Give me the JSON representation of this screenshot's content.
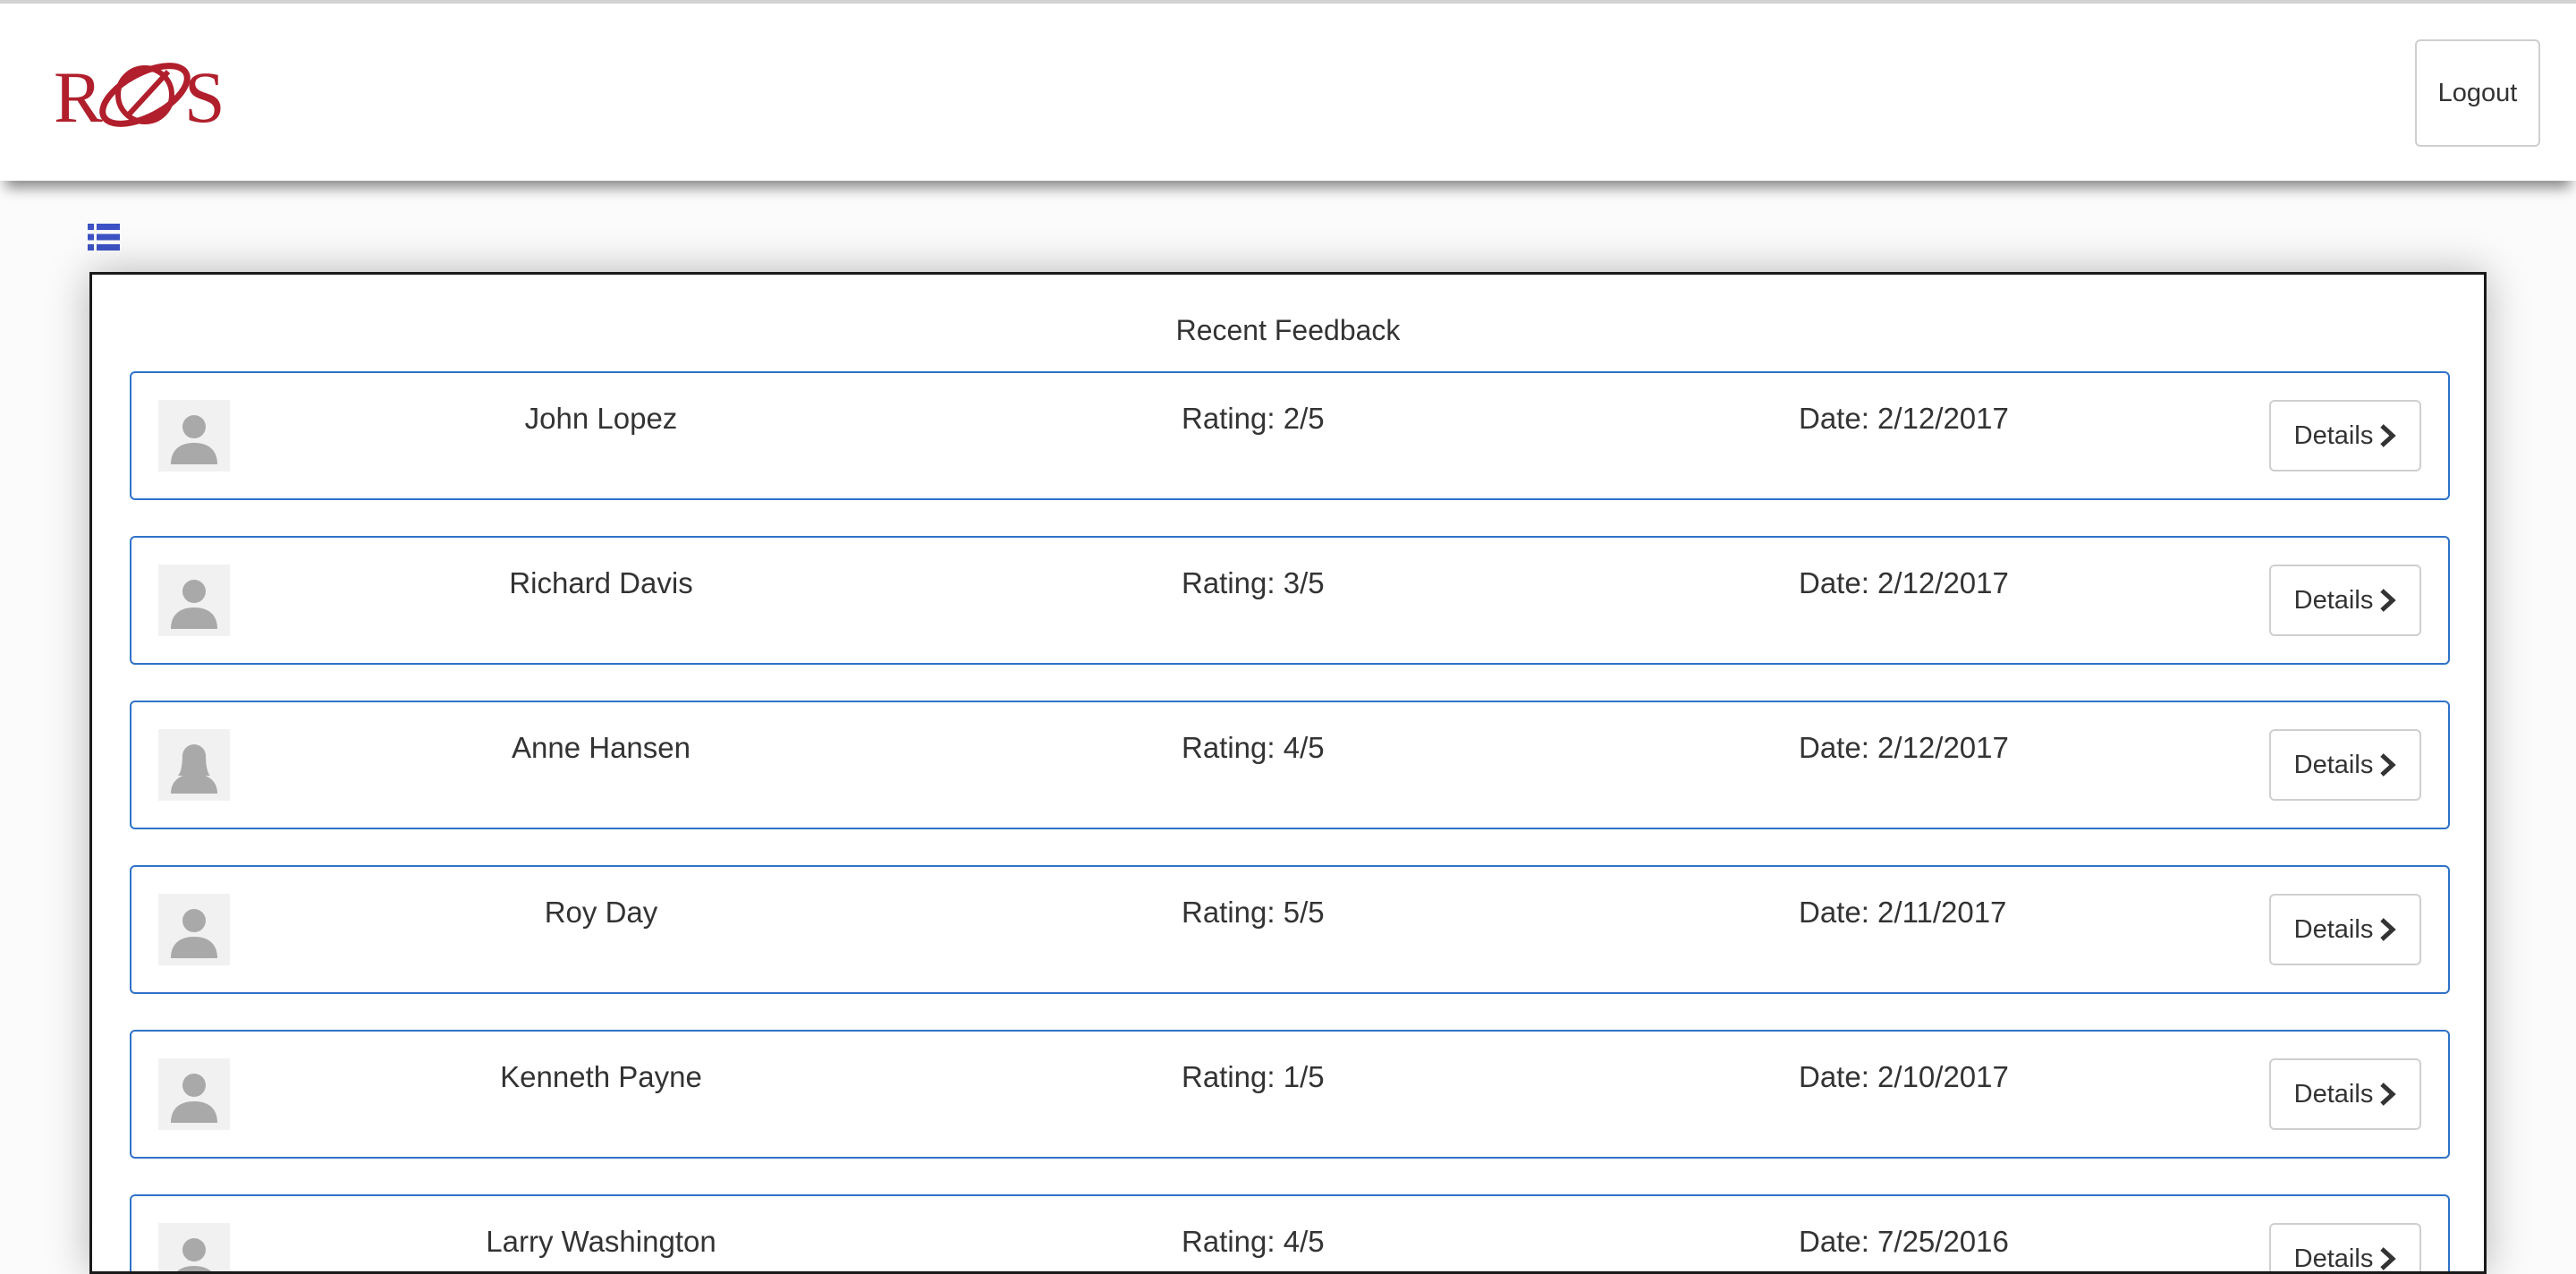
{
  "header": {
    "logo_text": "ROS",
    "logout_label": "Logout"
  },
  "colors": {
    "brand_red": "#b11f2c",
    "row_border": "#2f72c9",
    "list_icon": "#3d52c4"
  },
  "panel": {
    "title": "Recent Feedback"
  },
  "feedback": [
    {
      "name": "John Lopez",
      "rating": "Rating: 2/5",
      "date": "Date: 2/12/2017",
      "details_label": "Details",
      "avatar": "male"
    },
    {
      "name": "Richard Davis",
      "rating": "Rating: 3/5",
      "date": "Date: 2/12/2017",
      "details_label": "Details",
      "avatar": "male"
    },
    {
      "name": "Anne Hansen",
      "rating": "Rating: 4/5",
      "date": "Date: 2/12/2017",
      "details_label": "Details",
      "avatar": "female"
    },
    {
      "name": "Roy Day",
      "rating": "Rating: 5/5",
      "date": "Date: 2/11/2017",
      "details_label": "Details",
      "avatar": "male"
    },
    {
      "name": "Kenneth Payne",
      "rating": "Rating: 1/5",
      "date": "Date: 2/10/2017",
      "details_label": "Details",
      "avatar": "male"
    },
    {
      "name": "Larry Washington",
      "rating": "Rating: 4/5",
      "date": "Date: 7/25/2016",
      "details_label": "Details",
      "avatar": "male"
    }
  ]
}
